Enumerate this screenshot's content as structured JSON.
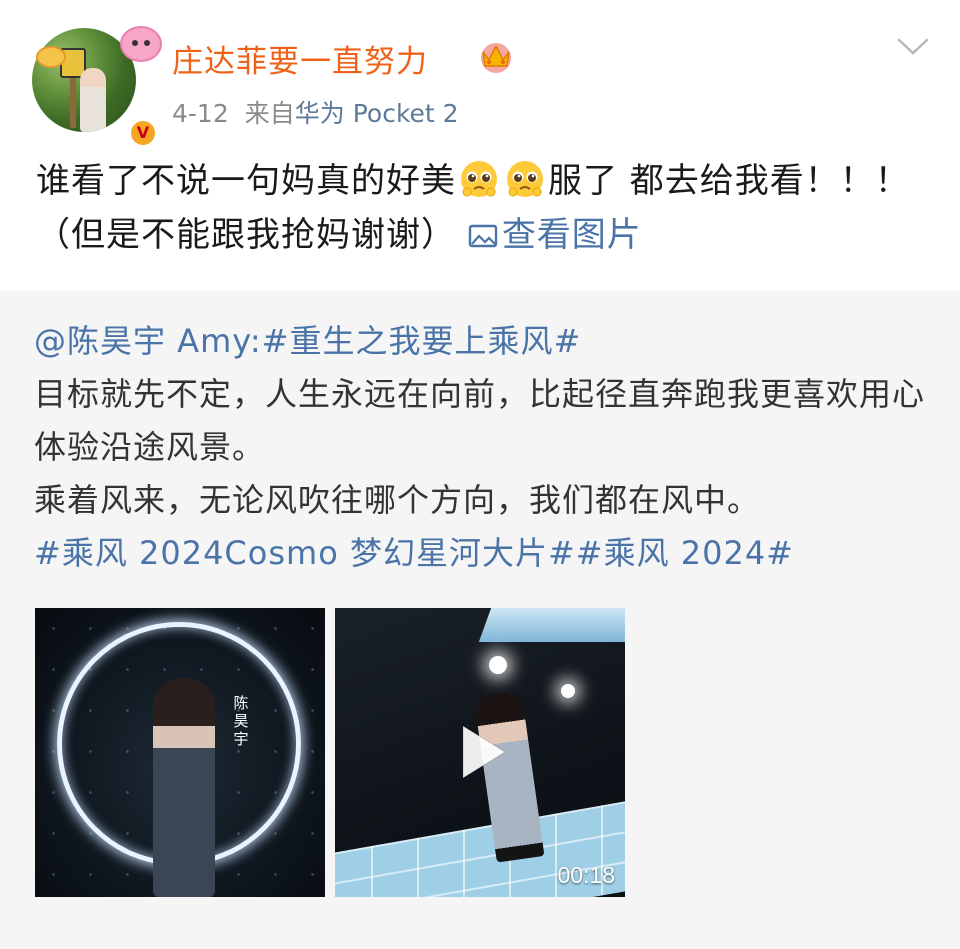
{
  "post": {
    "user_name": "庄达菲要一直努力",
    "date": "4-12",
    "source_prefix": "来自",
    "device": "华为 Pocket 2",
    "text_part1": "谁看了不说一句妈真的好美",
    "text_part2": "服了 都去给我看！！！（但是不能跟我抢妈谢谢）",
    "view_pictures": "查看图片",
    "verified_badge": "V",
    "icons": {
      "more": "chevron-down-icon",
      "crown": "crown-icon",
      "emoji": "pleading-face-emoji",
      "image": "image-icon"
    }
  },
  "repost": {
    "mention": "@陈昊宇 Amy:",
    "topic_main": "#重生之我要上乘风#",
    "line1": "目标就先不定，人生永远在向前，比起径直奔跑我更喜欢用心体验沿途风景。",
    "line2": "乘着风来，无论风吹往哪个方向，我们都在风中。",
    "hashtags": "#乘风 2024Cosmo 梦幻星河大片##乘风 2024#",
    "media": [
      {
        "type": "image",
        "overlay_text": "陈昊宇"
      },
      {
        "type": "video",
        "duration": "00:18"
      }
    ]
  },
  "colors": {
    "username": "#f06218",
    "link": "#4a74a8",
    "repost_bg": "#f5f5f5",
    "meta": "#8a8a8a"
  }
}
